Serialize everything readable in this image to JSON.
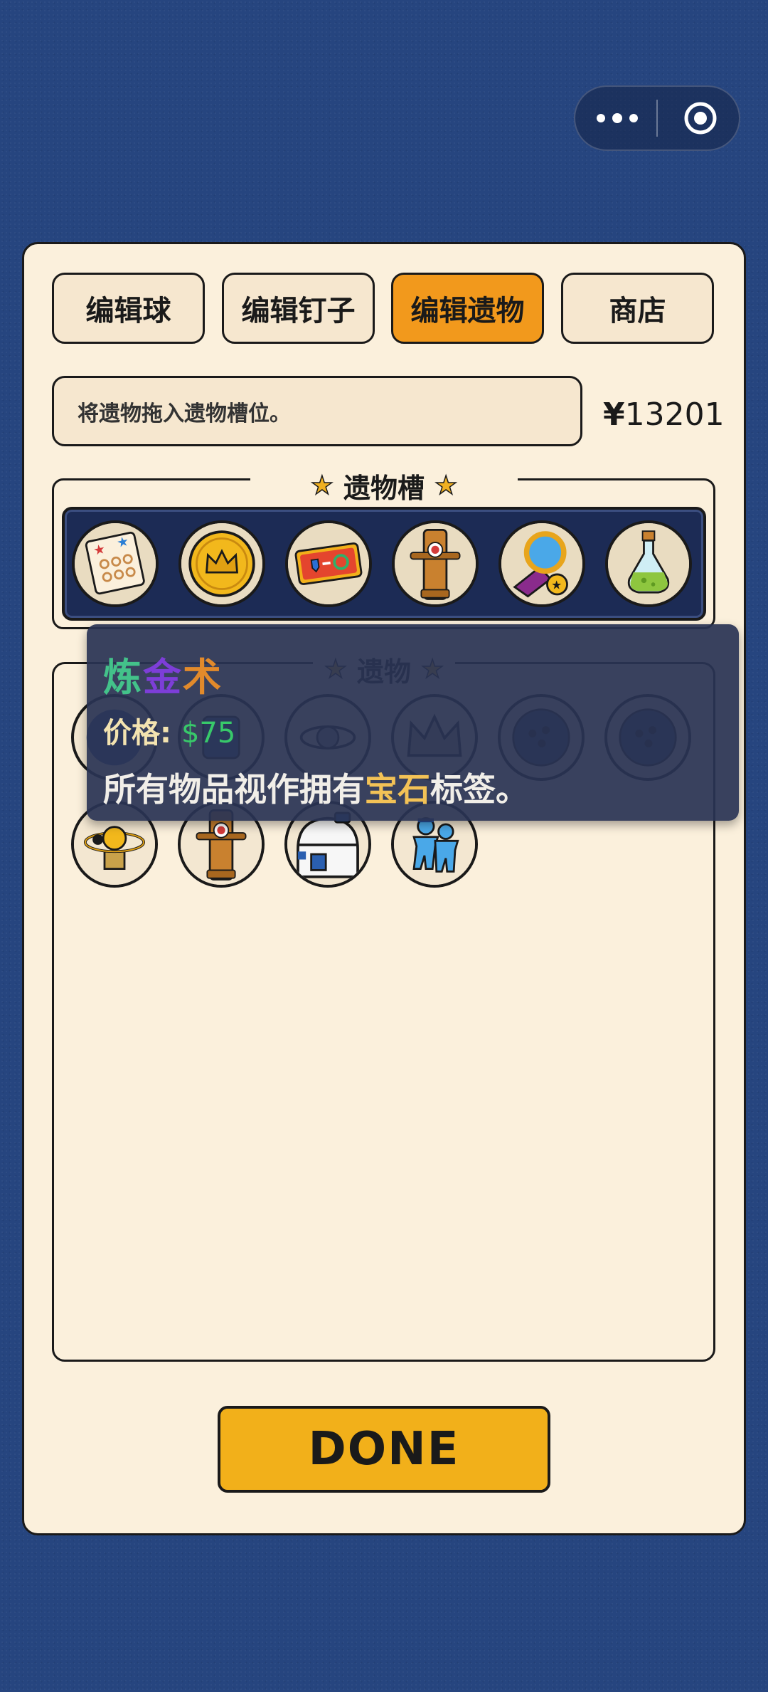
{
  "capsule": {
    "more_icon": "more-dots-icon",
    "close_icon": "target-circle-icon"
  },
  "tabs": [
    {
      "label": "编辑球",
      "active": false
    },
    {
      "label": "编辑钉子",
      "active": false
    },
    {
      "label": "编辑遗物",
      "active": true
    },
    {
      "label": "商店",
      "active": false
    }
  ],
  "hint": "将遗物拖入遗物槽位。",
  "money": {
    "symbol": "¥",
    "amount": "13201"
  },
  "relic_slots": {
    "title": "遗物槽",
    "items": [
      "map-scroll-icon",
      "gold-crown-coin-icon",
      "ticket-icon",
      "training-dummy-icon",
      "magnifier-star-icon",
      "potion-flask-icon"
    ]
  },
  "relics": {
    "title": "遗物",
    "row1": [
      "gem-bowl-icon",
      "cup-icon",
      "orbit-icon",
      "crown-icon",
      "dark-dish-icon",
      "dark-dish-icon"
    ],
    "row2": [
      "orbit-telescope-icon",
      "training-dummy-icon",
      "robot-head-icon",
      "blue-figures-icon"
    ]
  },
  "tooltip": {
    "name_parts": [
      "炼",
      "金",
      "术"
    ],
    "price_label": "价格",
    "price_sep": ":",
    "price_value": "$75",
    "desc_before": "所有物品视作拥有",
    "desc_highlight": "宝石",
    "desc_after": "标签。"
  },
  "done_label": "DONE",
  "colors": {
    "background": "#26457f",
    "panel": "#fbf0dc",
    "active_tab": "#f2991c",
    "done": "#f2b01a"
  }
}
